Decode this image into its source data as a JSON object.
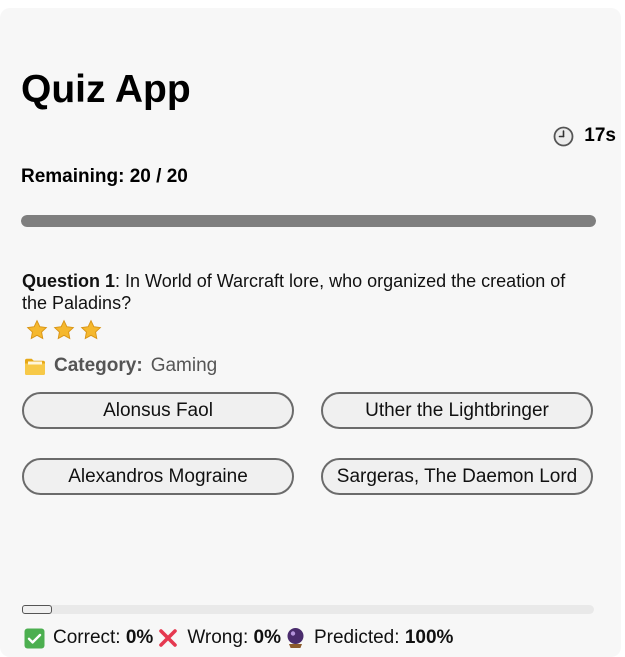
{
  "app": {
    "title": "Quiz App"
  },
  "timer": {
    "icon": "clock-icon",
    "value": "17s"
  },
  "remaining": {
    "label": "Remaining: 20 / 20",
    "fraction": 1.0
  },
  "question": {
    "label": "Question 1",
    "text": ": In World of Warcraft lore, who organized the creation of the Paladins?",
    "difficulty_stars": 3,
    "category_icon": "folder-icon",
    "category_label": "Category:",
    "category_value": "Gaming"
  },
  "answers": [
    "Alonsus Faol",
    "Uther the Lightbringer",
    "Alexandros Mograine",
    "Sargeras, The Daemon Lord"
  ],
  "progress": {
    "answered_fraction": 0.0
  },
  "stats": {
    "correct_icon": "check-icon",
    "correct_label": "Correct:",
    "correct_value": "0%",
    "wrong_icon": "cross-icon",
    "wrong_label": "Wrong:",
    "wrong_value": "0%",
    "predicted_icon": "crystal-ball-icon",
    "predicted_label": "Predicted:",
    "predicted_value": "100%"
  },
  "colors": {
    "progress_fill": "#7f7f7f",
    "star": "#f5b82e",
    "check_bg": "#4caf50",
    "cross": "#e53950"
  }
}
